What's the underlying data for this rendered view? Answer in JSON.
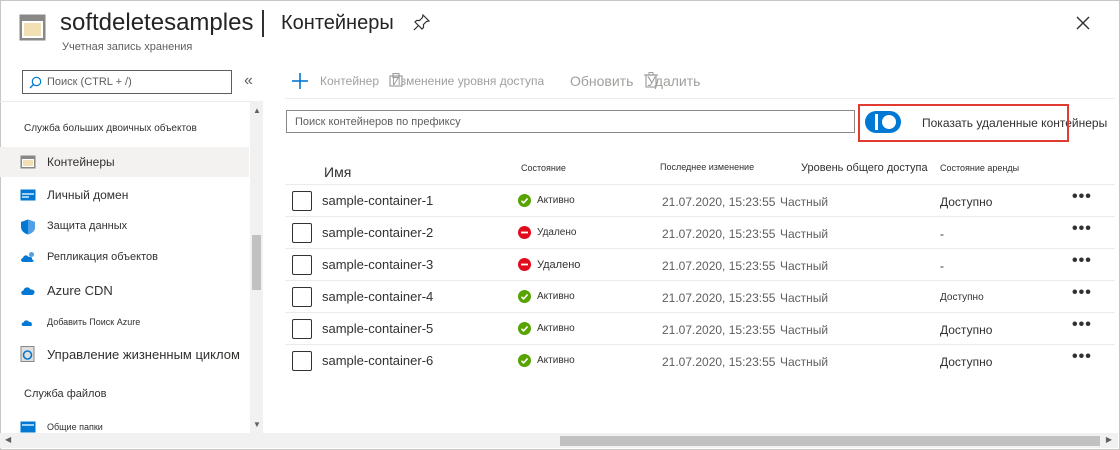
{
  "header": {
    "title": "softdeletesamples",
    "page": "Контейнеры",
    "subtitle": "Учетная запись хранения"
  },
  "sidebar": {
    "search_placeholder": "Поиск (CTRL + /)",
    "collapse_glyph": "«",
    "section1": "Служба больших двоичных объектов",
    "items": [
      {
        "label": "Контейнеры",
        "icon": "container-icon"
      },
      {
        "label": "Личный домен",
        "icon": "domain-icon"
      },
      {
        "label": "Защита данных",
        "icon": "shield-icon"
      },
      {
        "label": "Репликация объектов",
        "icon": "replication-icon"
      },
      {
        "label": "Azure CDN",
        "icon": "cloud-icon"
      },
      {
        "label": "Добавить Поиск Azure",
        "icon": "cloud-search-icon"
      },
      {
        "label": "Управление жизненным циклом",
        "icon": "lifecycle-icon"
      }
    ],
    "section2": "Служба файлов",
    "items2": [
      {
        "label": "Общие папки",
        "icon": "file-share-icon"
      }
    ]
  },
  "toolbar": {
    "add_container": "Контейнер",
    "change_tier": "Изменение уровня доступа",
    "refresh": "Обновить",
    "delete": "Удалить"
  },
  "filter": {
    "placeholder": "Поиск контейнеров по префиксу",
    "toggle_label": "Показать удаленные контейнеры",
    "toggle_on": true
  },
  "table": {
    "columns": {
      "name": "Имя",
      "state": "Состояние",
      "modified": "Последнее изменение",
      "access": "Уровень общего доступа",
      "lease": "Состояние аренды"
    },
    "rows": [
      {
        "name": "sample-container-1",
        "state": "Активно",
        "status": "active",
        "modified": "21.07.2020, 15:23:55",
        "access": "Частный",
        "lease": "Доступно"
      },
      {
        "name": "sample-container-2",
        "state": "Удалено",
        "status": "deleted",
        "modified": "21.07.2020, 15:23:55",
        "access": "Частный",
        "lease": "-"
      },
      {
        "name": "sample-container-3",
        "state": "Удалено",
        "status": "deleted",
        "modified": "21.07.2020, 15:23:55",
        "access": "Частный",
        "lease": "-"
      },
      {
        "name": "sample-container-4",
        "state": "Активно",
        "status": "active",
        "modified": "21.07.2020, 15:23:55",
        "access": "Частный",
        "lease": "Доступно"
      },
      {
        "name": "sample-container-5",
        "state": "Активно",
        "status": "active",
        "modified": "21.07.2020, 15:23:55",
        "access": "Частный",
        "lease": "Доступно"
      },
      {
        "name": "sample-container-6",
        "state": "Активно",
        "status": "active",
        "modified": "21.07.2020, 15:23:55",
        "access": "Частный",
        "lease": "Доступно"
      }
    ]
  },
  "colors": {
    "accent": "#0078d4",
    "active": "#57a300",
    "deleted": "#e00b1c",
    "highlight": "#e03c31"
  }
}
